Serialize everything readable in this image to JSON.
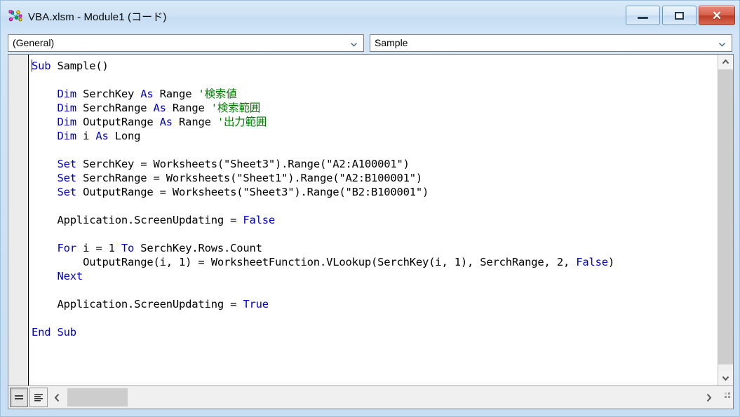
{
  "window": {
    "title": "VBA.xlsm - Module1 (コード)",
    "icon": "vba-module-icon",
    "buttons": {
      "minimize": "minimize-button",
      "maximize": "maximize-button",
      "close": "close-button",
      "minimize_glyph": "—",
      "maximize_glyph": "□",
      "close_glyph": "✕"
    },
    "colors": {
      "titlebar_top": "#d9eaf8",
      "titlebar_bottom": "#cfe4f6",
      "frame_border": "#9dc0dd",
      "close_button": "#bc3c26",
      "keyword_blue": "#0000cd",
      "comment_green": "#007a00",
      "margin_bar": "#ececec",
      "scrollbar_thumb": "#cdcdcd"
    }
  },
  "toolbar": {
    "object_combo": {
      "value": "(General)",
      "arrow": "chevron-down-icon"
    },
    "procedure_combo": {
      "value": "Sample",
      "arrow": "chevron-down-icon"
    }
  },
  "code": {
    "lines": [
      {
        "indent": 0,
        "parts": [
          {
            "t": "Sub",
            "c": "kw"
          },
          {
            "t": " Sample()",
            "c": ""
          }
        ]
      },
      {
        "indent": 0,
        "parts": []
      },
      {
        "indent": 1,
        "parts": [
          {
            "t": "Dim",
            "c": "kw"
          },
          {
            "t": " SerchKey ",
            "c": ""
          },
          {
            "t": "As",
            "c": "kw"
          },
          {
            "t": " Range ",
            "c": ""
          },
          {
            "t": "'検索値",
            "c": "cm"
          }
        ]
      },
      {
        "indent": 1,
        "parts": [
          {
            "t": "Dim",
            "c": "kw"
          },
          {
            "t": " SerchRange ",
            "c": ""
          },
          {
            "t": "As",
            "c": "kw"
          },
          {
            "t": " Range ",
            "c": ""
          },
          {
            "t": "'検索範囲",
            "c": "cm"
          }
        ]
      },
      {
        "indent": 1,
        "parts": [
          {
            "t": "Dim",
            "c": "kw"
          },
          {
            "t": " OutputRange ",
            "c": ""
          },
          {
            "t": "As",
            "c": "kw"
          },
          {
            "t": " Range ",
            "c": ""
          },
          {
            "t": "'出力範囲",
            "c": "cm"
          }
        ]
      },
      {
        "indent": 1,
        "parts": [
          {
            "t": "Dim",
            "c": "kw"
          },
          {
            "t": " i ",
            "c": ""
          },
          {
            "t": "As",
            "c": "kw"
          },
          {
            "t": " Long",
            "c": ""
          }
        ]
      },
      {
        "indent": 0,
        "parts": []
      },
      {
        "indent": 1,
        "parts": [
          {
            "t": "Set",
            "c": "kw"
          },
          {
            "t": " SerchKey = Worksheets(\"Sheet3\").Range(\"A2:A100001\")",
            "c": ""
          }
        ]
      },
      {
        "indent": 1,
        "parts": [
          {
            "t": "Set",
            "c": "kw"
          },
          {
            "t": " SerchRange = Worksheets(\"Sheet1\").Range(\"A2:B100001\")",
            "c": ""
          }
        ]
      },
      {
        "indent": 1,
        "parts": [
          {
            "t": "Set",
            "c": "kw"
          },
          {
            "t": " OutputRange = Worksheets(\"Sheet3\").Range(\"B2:B100001\")",
            "c": ""
          }
        ]
      },
      {
        "indent": 0,
        "parts": []
      },
      {
        "indent": 1,
        "parts": [
          {
            "t": "Application.ScreenUpdating = ",
            "c": ""
          },
          {
            "t": "False",
            "c": "kw"
          }
        ]
      },
      {
        "indent": 0,
        "parts": []
      },
      {
        "indent": 1,
        "parts": [
          {
            "t": "For",
            "c": "kw"
          },
          {
            "t": " i = 1 ",
            "c": ""
          },
          {
            "t": "To",
            "c": "kw"
          },
          {
            "t": " SerchKey.Rows.Count",
            "c": ""
          }
        ]
      },
      {
        "indent": 2,
        "parts": [
          {
            "t": "OutputRange(i, 1) = WorksheetFunction.VLookup(SerchKey(i, 1), SerchRange, 2, ",
            "c": ""
          },
          {
            "t": "False",
            "c": "kw"
          },
          {
            "t": ")",
            "c": ""
          }
        ]
      },
      {
        "indent": 1,
        "parts": [
          {
            "t": "Next",
            "c": "kw"
          }
        ]
      },
      {
        "indent": 0,
        "parts": []
      },
      {
        "indent": 1,
        "parts": [
          {
            "t": "Application.ScreenUpdating = ",
            "c": ""
          },
          {
            "t": "True",
            "c": "kw"
          }
        ]
      },
      {
        "indent": 0,
        "parts": []
      },
      {
        "indent": 0,
        "parts": [
          {
            "t": "End Sub",
            "c": "kw"
          }
        ]
      }
    ]
  },
  "statusbar": {
    "procedure_view_button": "Procedure View",
    "full_module_view_button": "Full Module View",
    "scroll_left": "chevron-left-icon",
    "scroll_right": "chevron-right-icon",
    "resize_grip": "resize-grip-icon"
  }
}
